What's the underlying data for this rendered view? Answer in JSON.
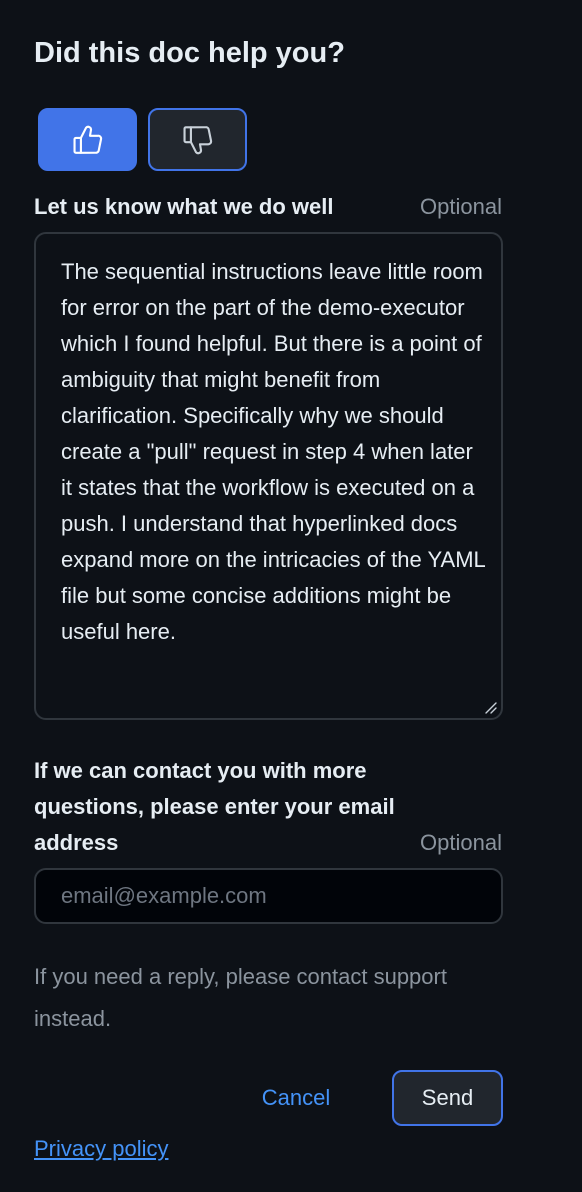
{
  "heading": "Did this doc help you?",
  "vote": {
    "up_icon": "thumbs-up-icon",
    "down_icon": "thumbs-down-icon",
    "selected": "up"
  },
  "feedback": {
    "label": "Let us know what we do well",
    "optional_label": "Optional",
    "text": "The sequential instructions leave little room for error on the part of the demo-executor which I found helpful. But there is a point of ambiguity that might benefit from clarification. Specifically why we should create a \"pull\" request in step 4 when later it states that the workflow is executed on a push. I understand that hyperlinked docs expand more on the intricacies of the YAML file but some concise additions might be useful here."
  },
  "email": {
    "label": "If we can contact you with more questions, please enter your email address",
    "optional_label": "Optional",
    "value": "",
    "placeholder": "email@example.com"
  },
  "note": "If you need a reply, please contact support instead.",
  "actions": {
    "cancel_label": "Cancel",
    "send_label": "Send"
  },
  "privacy_link": "Privacy policy",
  "colors": {
    "background": "#0d1117",
    "accent": "#4174e8",
    "link": "#4493f8",
    "muted_text": "#8b949e"
  }
}
